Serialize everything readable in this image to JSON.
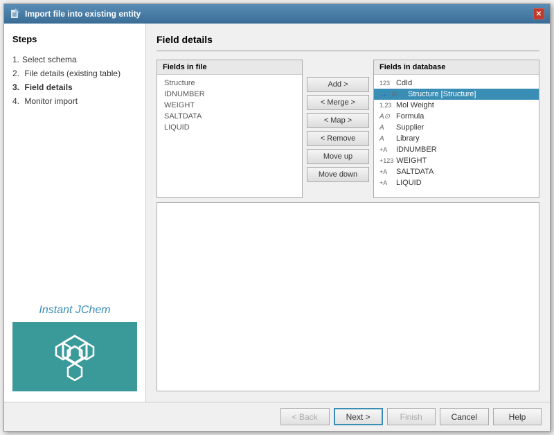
{
  "dialog": {
    "title": "Import file into existing entity",
    "title_icon": "import-icon"
  },
  "sidebar": {
    "title": "Steps",
    "steps": [
      {
        "num": "1.",
        "label": "Select schema",
        "active": false
      },
      {
        "num": "2.",
        "label": "File details (existing table)",
        "active": false
      },
      {
        "num": "3.",
        "label": "Field details",
        "active": true
      },
      {
        "num": "4.",
        "label": "Monitor import",
        "active": false
      }
    ],
    "brand_name": "Instant JChem"
  },
  "main": {
    "panel_title": "Field details",
    "fields_in_file_header": "Fields in file",
    "fields_in_db_header": "Fields in database",
    "fields_in_file": [
      {
        "label": "Structure"
      },
      {
        "label": "IDNUMBER"
      },
      {
        "label": "WEIGHT"
      },
      {
        "label": "SALTDATA"
      },
      {
        "label": "LIQUID"
      }
    ],
    "fields_in_db": [
      {
        "type": "123",
        "label": "CdId",
        "arrow": false
      },
      {
        "type": "O",
        "label": "Structure [Structure]",
        "arrow": true,
        "is_structure": true
      },
      {
        "type": "1,23",
        "label": "Mol Weight",
        "arrow": false
      },
      {
        "type": "A",
        "label": "Formula",
        "arrow": false,
        "has_dot": true
      },
      {
        "type": "A",
        "label": "Supplier",
        "arrow": false
      },
      {
        "type": "A",
        "label": "Library",
        "arrow": false
      },
      {
        "type": "+A",
        "label": "IDNUMBER",
        "arrow": false
      },
      {
        "type": "+123",
        "label": "WEIGHT",
        "arrow": false
      },
      {
        "type": "+A",
        "label": "SALTDATA",
        "arrow": false
      },
      {
        "type": "+A",
        "label": "LIQUID",
        "arrow": false,
        "truncated": true
      }
    ],
    "buttons": {
      "add": "Add >",
      "merge": "< Merge >",
      "map": "< Map >",
      "remove": "< Remove",
      "move_up": "Move up",
      "move_down": "Move down"
    },
    "footer": {
      "back": "< Back",
      "next": "Next >",
      "finish": "Finish",
      "cancel": "Cancel",
      "help": "Help"
    }
  }
}
